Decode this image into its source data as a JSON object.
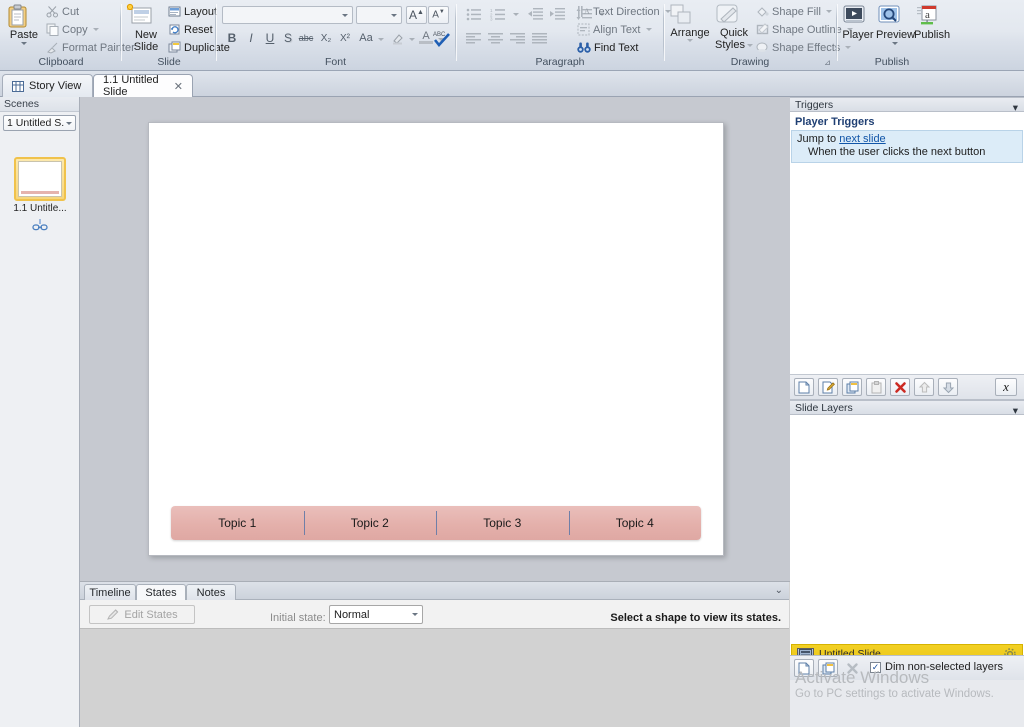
{
  "ribbon": {
    "groups": [
      {
        "name": "Clipboard",
        "label": "Clipboard"
      },
      {
        "name": "Slide",
        "label": "Slide"
      },
      {
        "name": "Font",
        "label": "Font"
      },
      {
        "name": "Paragraph",
        "label": "Paragraph"
      },
      {
        "name": "Drawing",
        "label": "Drawing"
      },
      {
        "name": "Publish",
        "label": "Publish"
      }
    ],
    "clipboard": {
      "paste": "Paste",
      "cut": "Cut",
      "copy": "Copy",
      "format_painter": "Format Painter"
    },
    "slide": {
      "new_slide": "New\nSlide",
      "new_slide_line1": "New",
      "new_slide_line2": "Slide",
      "layout": "Layout",
      "reset": "Reset",
      "duplicate": "Duplicate"
    },
    "font": {
      "font_family_value": "",
      "font_size_value": "",
      "grow_font": "A",
      "shrink_font": "A",
      "clear_formatting": "clear-formatting",
      "bold": "B",
      "italic": "I",
      "underline": "U",
      "shadow": "S",
      "strikethrough": "abc",
      "subscript": "X₂",
      "superscript": "X²",
      "change_case": "Aa",
      "text_highlight": "highlight",
      "font_color": "A",
      "spelling": "ABC"
    },
    "paragraph": {
      "text_direction": "Text Direction",
      "align_text": "Align Text",
      "find_text": "Find Text"
    },
    "drawing": {
      "arrange": "Arrange",
      "quick_styles_line1": "Quick",
      "quick_styles_line2": "Styles",
      "shape_fill": "Shape Fill",
      "shape_outline": "Shape Outline",
      "shape_effects": "Shape Effects"
    },
    "publish": {
      "player": "Player",
      "preview": "Preview",
      "publish": "Publish"
    }
  },
  "tabs": [
    {
      "label": "Story View",
      "icon": "story-view-icon",
      "active": false,
      "closable": false
    },
    {
      "label": "1.1 Untitled Slide",
      "icon": "",
      "active": true,
      "closable": true,
      "close_glyph": "✕"
    }
  ],
  "left_panel": {
    "header": "Scenes",
    "scene_selector_value": "1 Untitled S...",
    "thumbnail_label": "1.1 Untitle...",
    "thumbnail_link_icon": "link-icon"
  },
  "slide": {
    "topics": [
      "Topic 1",
      "Topic 2",
      "Topic 3",
      "Topic 4"
    ],
    "topic_bar_color": "#e4b0ab"
  },
  "bottom_panel": {
    "tabs": [
      {
        "label": "Timeline",
        "active": false
      },
      {
        "label": "States",
        "active": true
      },
      {
        "label": "Notes",
        "active": false
      }
    ],
    "collapse_glyph": "⌄",
    "edit_states_button": "Edit States",
    "edit_states_icon": "pencil-icon",
    "initial_state_label": "Initial state:",
    "initial_state_value": "Normal",
    "status_hint": "Select a shape to view its states."
  },
  "triggers_panel": {
    "header": "Triggers",
    "collapse_glyph": "▾",
    "section_title": "Player Triggers",
    "items": [
      {
        "action_prefix": "Jump to",
        "action_target": "next slide",
        "condition": "When the user clicks the next button"
      }
    ],
    "toolbar": [
      {
        "name": "new-trigger-button",
        "glyph": "⬜",
        "disabled": false
      },
      {
        "name": "edit-trigger-button",
        "glyph": "✎",
        "disabled": false
      },
      {
        "name": "copy-trigger-button",
        "glyph": "⧉",
        "disabled": false
      },
      {
        "name": "paste-trigger-button",
        "glyph": "⎙",
        "disabled": true
      },
      {
        "name": "delete-trigger-button",
        "glyph": "✕",
        "disabled": false
      },
      {
        "name": "move-up-button",
        "glyph": "⌃",
        "disabled": true
      },
      {
        "name": "move-down-button",
        "glyph": "⬇",
        "disabled": true
      },
      {
        "name": "trigger-variables-button",
        "glyph": "𝑥",
        "disabled": false
      }
    ]
  },
  "layers_panel": {
    "header": "Slide Layers",
    "collapse_glyph": "▾",
    "base_layer": {
      "name": "Untitled Slide",
      "icon": "slide-icon",
      "gear_icon": "gear-icon"
    },
    "toolbar": [
      {
        "name": "new-layer-button",
        "glyph": "⬜",
        "disabled": false
      },
      {
        "name": "duplicate-layer-button",
        "glyph": "⧉",
        "disabled": false
      },
      {
        "name": "delete-layer-button",
        "glyph": "✕",
        "disabled": true
      }
    ],
    "dim_checkbox_label": "Dim non-selected layers",
    "dim_checkbox_checked": true,
    "check_glyph": "✓"
  },
  "watermark": {
    "line1": "Activate Windows",
    "line2": "Go to PC settings to activate Windows."
  }
}
